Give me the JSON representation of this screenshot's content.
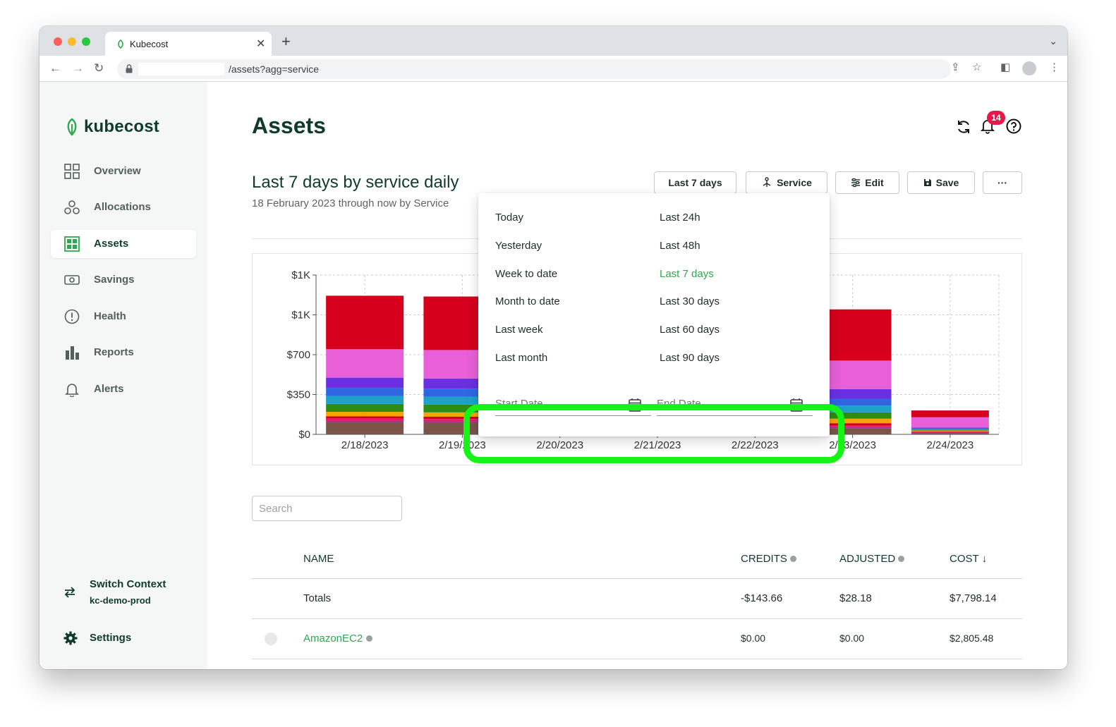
{
  "browser": {
    "tab_title": "Kubecost",
    "url": "/assets?agg=service"
  },
  "sidebar": {
    "logo_text": "kubecost",
    "items": [
      {
        "label": "Overview",
        "icon": "grid-icon"
      },
      {
        "label": "Allocations",
        "icon": "allocations-icon"
      },
      {
        "label": "Assets",
        "icon": "assets-grid-icon",
        "active": true
      },
      {
        "label": "Savings",
        "icon": "savings-icon"
      },
      {
        "label": "Health",
        "icon": "health-icon"
      },
      {
        "label": "Reports",
        "icon": "bar-chart-icon"
      },
      {
        "label": "Alerts",
        "icon": "bell-icon"
      }
    ],
    "context": {
      "title": "Switch Context",
      "value": "kc-demo-prod"
    },
    "settings_label": "Settings"
  },
  "header": {
    "title": "Assets",
    "notification_count": "14"
  },
  "report": {
    "title": "Last 7 days by service daily",
    "subtitle": "18 February 2023 through now by Service"
  },
  "toolbar": {
    "date_range_label": "Last 7 days",
    "aggregate_label": "Service",
    "edit_label": "Edit",
    "save_label": "Save",
    "more_label": "···"
  },
  "date_menu": {
    "left_options": [
      "Today",
      "Yesterday",
      "Week to date",
      "Month to date",
      "Last week",
      "Last month"
    ],
    "right_options": [
      "Last 24h",
      "Last 48h",
      "Last 7 days",
      "Last 30 days",
      "Last 60 days",
      "Last 90 days"
    ],
    "selected": "Last 7 days",
    "start_placeholder": "Start Date",
    "end_placeholder": "End Date"
  },
  "chart_data": {
    "type": "bar",
    "stacked": true,
    "categories": [
      "2/18/2023",
      "2/19/2023",
      "2/20/2023",
      "2/21/2023",
      "2/22/2023",
      "2/23/2023",
      "2/24/2023"
    ],
    "y_tick_labels": [
      "$0",
      "$350",
      "$700",
      "$1K",
      "$1K"
    ],
    "ylim": [
      0,
      1400
    ],
    "grid": true,
    "series": [
      {
        "color": "#7a5548",
        "values": [
          108,
          105,
          null,
          null,
          null,
          55,
          10
        ]
      },
      {
        "color": "#9c2f9c",
        "values": [
          10,
          10,
          null,
          null,
          null,
          8,
          5
        ]
      },
      {
        "color": "#e8196c",
        "values": [
          20,
          20,
          null,
          null,
          null,
          15,
          6
        ]
      },
      {
        "color": "#d4001e",
        "values": [
          20,
          20,
          null,
          null,
          null,
          20,
          5
        ]
      },
      {
        "color": "#f5a400",
        "values": [
          40,
          38,
          null,
          null,
          null,
          40,
          8
        ]
      },
      {
        "color": "#2e8b14",
        "values": [
          70,
          68,
          null,
          null,
          null,
          55,
          6
        ]
      },
      {
        "color": "#1da1c9",
        "values": [
          70,
          70,
          null,
          null,
          null,
          60,
          6
        ]
      },
      {
        "color": "#2f67e3",
        "values": [
          70,
          70,
          null,
          null,
          null,
          60,
          6
        ]
      },
      {
        "color": "#6a2fe0",
        "values": [
          90,
          90,
          null,
          null,
          null,
          85,
          8
        ]
      },
      {
        "color": "#e85fd8",
        "values": [
          250,
          250,
          null,
          null,
          null,
          250,
          90
        ]
      },
      {
        "color": "#d6001c",
        "values": [
          470,
          470,
          null,
          null,
          null,
          450,
          60
        ]
      }
    ]
  },
  "search": {
    "placeholder": "Search"
  },
  "table": {
    "headers": {
      "name": "NAME",
      "credits": "CREDITS",
      "adjusted": "ADJUSTED",
      "cost": "COST"
    },
    "sort_indicator": "↓",
    "totals": {
      "name": "Totals",
      "credits": "-$143.66",
      "adjusted": "$28.18",
      "cost": "$7,798.14"
    },
    "rows": [
      {
        "name": "AmazonEC2",
        "credits": "$0.00",
        "adjusted": "$0.00",
        "cost": "$2,805.48"
      }
    ]
  },
  "colors": {
    "accent": "#2fa84f",
    "brand": "#0f3b2d",
    "highlight": "#16f316",
    "badge": "#e8174a"
  }
}
